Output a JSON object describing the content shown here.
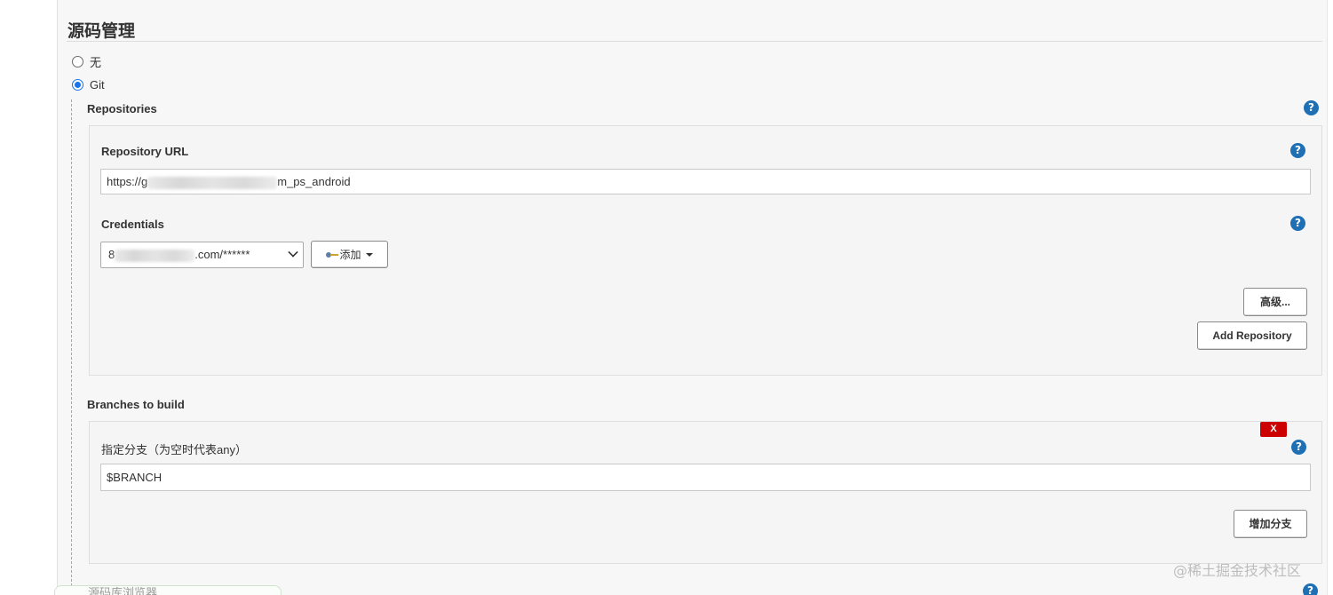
{
  "section": {
    "title": "源码管理"
  },
  "scm_options": [
    {
      "label": "无",
      "selected": false
    },
    {
      "label": "Git",
      "selected": true
    }
  ],
  "repositories": {
    "label": "Repositories",
    "repository_url": {
      "label": "Repository URL",
      "value_prefix": "https://g",
      "value_suffix": "m_ps_android"
    },
    "credentials": {
      "label": "Credentials",
      "selected_prefix": "8",
      "selected_suffix": ".com/******",
      "add_button_label": "添加"
    },
    "advanced_button_label": "高级...",
    "add_repository_button_label": "Add Repository"
  },
  "branches": {
    "label": "Branches to build",
    "delete_button_label": "X",
    "branch_specifier": {
      "label": "指定分支（为空时代表any）",
      "value": "$BRANCH"
    },
    "add_branch_button_label": "增加分支"
  },
  "bottom_tab": {
    "label": "源码库浏览器"
  },
  "help_icon_glyph": "?",
  "watermark": "@稀土掘金技术社区",
  "colors": {
    "help_icon": "#1f6fb5",
    "delete_button": "#cc0000",
    "radio_checked": "#1a73e8",
    "panel_background": "#f5f5f5"
  }
}
